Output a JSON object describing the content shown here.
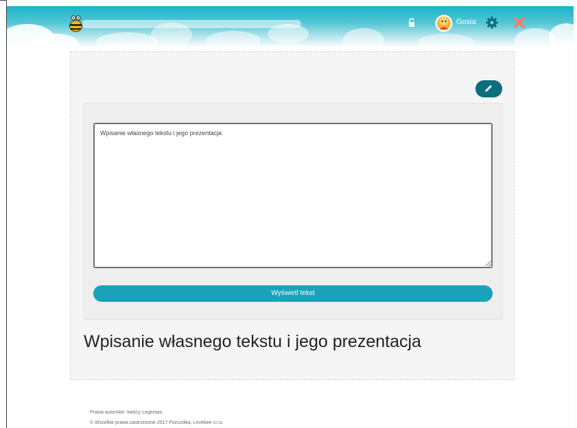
{
  "header": {
    "user_name": "Gosia",
    "icons": [
      "bee-logo",
      "lock-icon",
      "avatar",
      "gear-icon",
      "close-icon"
    ],
    "colors": {
      "header_top": "#1ab3c7",
      "gear": "#0b6e7d",
      "close": "#ff7a6b"
    }
  },
  "editor": {
    "textarea_value": "Wpisanie własnego tekstu i jego prezentacja",
    "button_label": "Wyświetl tekst",
    "edit_icon": "pencil-icon"
  },
  "output": {
    "displayed_text": "Wpisanie własnego tekstu i jego prezentacja"
  },
  "footer": {
    "line1": "Prawa autorskie: twórcy Legentas.",
    "line2": "© Wszelkie prawa zastrzeżone 2017 Pszczółka, Levebee s.r.o."
  },
  "colors": {
    "accent": "#1aa2bb",
    "edit_button": "#0c6f7e"
  }
}
